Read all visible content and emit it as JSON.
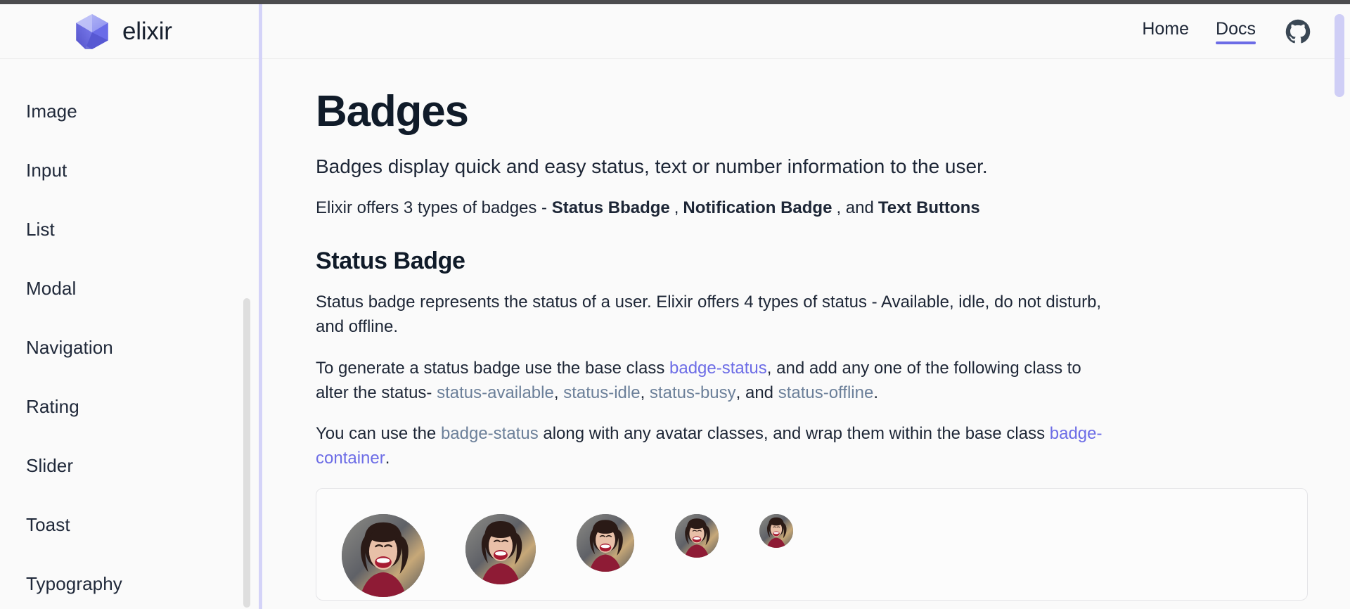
{
  "brand": {
    "name": "elixir",
    "logo_icon": "elixir-polyhedron-logo"
  },
  "sidebar": {
    "items": [
      {
        "label": "Image"
      },
      {
        "label": "Input"
      },
      {
        "label": "List"
      },
      {
        "label": "Modal"
      },
      {
        "label": "Navigation"
      },
      {
        "label": "Rating"
      },
      {
        "label": "Slider"
      },
      {
        "label": "Toast"
      },
      {
        "label": "Typography"
      }
    ]
  },
  "topnav": {
    "links": [
      {
        "label": "Home",
        "active": false
      },
      {
        "label": "Docs",
        "active": true
      }
    ],
    "github_icon": "github-icon"
  },
  "main": {
    "title": "Badges",
    "lead": "Badges display quick and easy status, text or number information to the user.",
    "types_line": {
      "prefix": "Elixir offers 3 types of badges - ",
      "type1": "Status Bbadge",
      "sep1": ",",
      "type2": "Notification Badge",
      "sep2": ", and",
      "type3": "Text Buttons"
    },
    "section": {
      "title": "Status Badge",
      "paragraph1": "Status badge represents the status of a user. Elixir offers 4 types of status - Available, idle, do not disturb, and offline.",
      "paragraph2": {
        "part1": "To generate a status badge use the base class ",
        "code1": "badge-status",
        "part2": ", and add any one of the following class to alter the status- ",
        "code2": "status-available",
        "part3": ", ",
        "code3": "status-idle",
        "part4": ", ",
        "code4": "status-busy",
        "part5": ", and ",
        "code5": "status-offline",
        "part6": "."
      },
      "paragraph3": {
        "part1": "You can use the ",
        "code1": "badge-status",
        "part2": " along with any avatar classes, and wrap them within the base class ",
        "code2": "badge-container",
        "part3": "."
      }
    },
    "demo": {
      "avatar_label": "avatar",
      "avatar_sizes": [
        118,
        100,
        82,
        62,
        48
      ]
    }
  },
  "colors": {
    "accent": "#6c6ce6",
    "slate_code": "#6b7f99",
    "text": "#1d2636",
    "heading": "#101b29",
    "sidebar_divider": "#d4d3f8",
    "page_bg": "#fafafa"
  }
}
